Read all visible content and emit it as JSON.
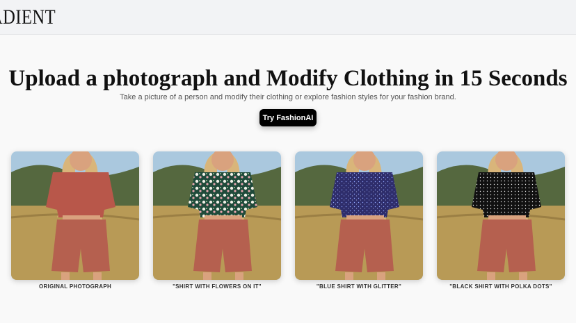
{
  "header": {
    "logo_text": "ADIENT"
  },
  "hero": {
    "title": "Upload a photograph and Modify Clothing in 15 Seconds",
    "subtitle": "Take a picture of a person and modify their clothing or explore fashion styles for your fashion brand.",
    "cta_label": "Try FashionAI"
  },
  "gallery": [
    {
      "caption": "ORIGINAL PHOTOGRAPH",
      "shirt": "plain-rust",
      "shirt_color": "#b8574a"
    },
    {
      "caption": "\"SHIRT WITH FLOWERS ON IT\"",
      "shirt": "floral",
      "shirt_color": "#1f4a3a"
    },
    {
      "caption": "\"BLUE SHIRT WITH GLITTER\"",
      "shirt": "glitter",
      "shirt_color": "#2e2d6b"
    },
    {
      "caption": "\"BLACK SHIRT WITH POLKA DOTS\"",
      "shirt": "polka",
      "shirt_color": "#111111"
    }
  ],
  "colors": {
    "shorts": "#b5604f",
    "sky": "#aac8de",
    "hills": "#55683f",
    "grass": "#b89a56",
    "hair": "#d9b57a",
    "skin": "#d9a27e"
  }
}
